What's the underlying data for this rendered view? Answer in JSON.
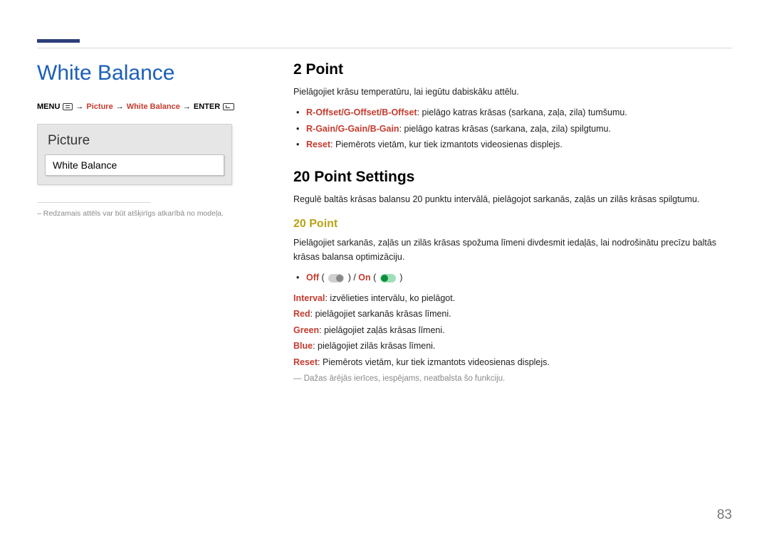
{
  "pageNumber": "83",
  "left": {
    "heading": "White Balance",
    "breadcrumb": {
      "menu": "MENU",
      "arrow": "→",
      "picture": "Picture",
      "whiteBalance": "White Balance",
      "enter": "ENTER"
    },
    "panel": {
      "title": "Picture",
      "item": "White Balance"
    },
    "footnote": "– Redzamais attēls var būt atšķirīgs atkarībā no modeļa."
  },
  "right": {
    "section1": {
      "heading": "2 Point",
      "intro": "Pielāgojiet krāsu temperatūru, lai iegūtu dabiskāku attēlu.",
      "bullets": [
        {
          "label": "R-Offset/G-Offset/B-Offset",
          "text": ": pielāgo katras krāsas (sarkana, zaļa, zila) tumšumu."
        },
        {
          "label": "R-Gain/G-Gain/B-Gain",
          "text": ": pielāgo katras krāsas (sarkana, zaļa, zila) spilgtumu."
        },
        {
          "label": "Reset",
          "text": ": Piemērots vietām, kur tiek izmantots videosienas displejs."
        }
      ]
    },
    "section2": {
      "heading": "20 Point Settings",
      "intro": "Regulē baltās krāsas balansu 20 punktu intervālā, pielāgojot sarkanās, zaļās un zilās krāsas spilgtumu.",
      "sub": {
        "heading": "20 Point",
        "intro": "Pielāgojiet sarkanās, zaļās un zilās krāsas spožuma līmeni divdesmit iedaļās, lai nodrošinātu precīzu baltās krāsas balansa optimizāciju.",
        "toggle": {
          "off": "Off",
          "sep": " / ",
          "on": "On"
        },
        "lines": [
          {
            "label": "Interval",
            "text": ": izvēlieties intervālu, ko pielāgot."
          },
          {
            "label": "Red",
            "text": ": pielāgojiet sarkanās krāsas līmeni."
          },
          {
            "label": "Green",
            "text": ": pielāgojiet zaļās krāsas līmeni."
          },
          {
            "label": "Blue",
            "text": ": pielāgojiet zilās krāsas līmeni."
          },
          {
            "label": "Reset",
            "text": ": Piemērots vietām, kur tiek izmantots videosienas displejs."
          }
        ],
        "note": "Dažas ārējās ierīces, iespējams, neatbalsta šo funkciju."
      }
    }
  }
}
